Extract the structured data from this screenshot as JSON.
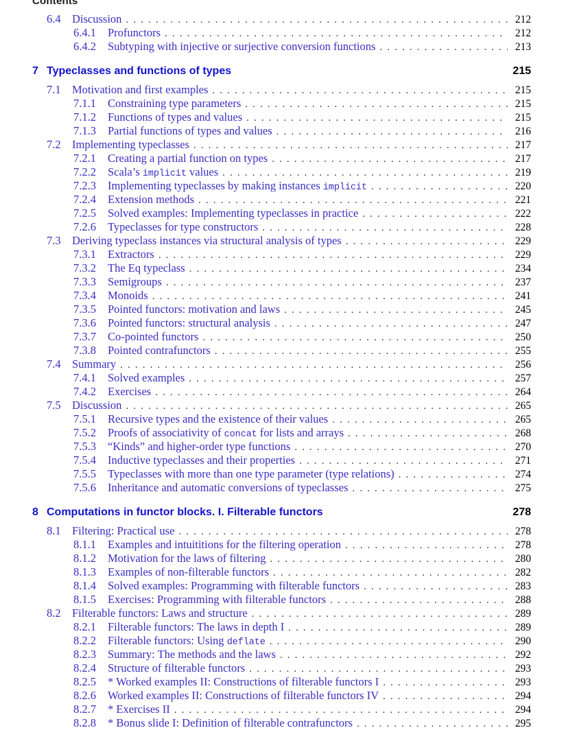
{
  "header": {
    "running_title": "Contents"
  },
  "toc": {
    "entries": [
      {
        "level": "section",
        "number": "6.4",
        "title": "Discussion",
        "page": "212"
      },
      {
        "level": "subsection",
        "number": "6.4.1",
        "title": "Profunctors",
        "page": "212"
      },
      {
        "level": "subsection",
        "number": "6.4.2",
        "title": "Subtyping with injective or surjective conversion functions",
        "page": "213"
      },
      {
        "level": "chapter",
        "number": "7",
        "title": "Typeclasses and functions of types",
        "page": "215"
      },
      {
        "level": "section",
        "number": "7.1",
        "title": "Motivation and first examples",
        "page": "215"
      },
      {
        "level": "subsection",
        "number": "7.1.1",
        "title": "Constraining type parameters",
        "page": "215"
      },
      {
        "level": "subsection",
        "number": "7.1.2",
        "title": "Functions of types and values",
        "page": "215"
      },
      {
        "level": "subsection",
        "number": "7.1.3",
        "title": "Partial functions of types and values",
        "page": "216"
      },
      {
        "level": "section",
        "number": "7.2",
        "title": "Implementing typeclasses",
        "page": "217"
      },
      {
        "level": "subsection",
        "number": "7.2.1",
        "title": "Creating a partial function on types",
        "page": "217"
      },
      {
        "level": "subsection",
        "number": "7.2.2",
        "title": "Scala’s implicit values",
        "title_parts": [
          {
            "t": "Scala’s ",
            "mono": false
          },
          {
            "t": "implicit",
            "mono": true
          },
          {
            "t": " values",
            "mono": false
          }
        ],
        "page": "219"
      },
      {
        "level": "subsection",
        "number": "7.2.3",
        "title": "Implementing typeclasses by making instances implicit",
        "title_parts": [
          {
            "t": "Implementing typeclasses by making instances ",
            "mono": false
          },
          {
            "t": "implicit",
            "mono": true
          }
        ],
        "page": "220"
      },
      {
        "level": "subsection",
        "number": "7.2.4",
        "title": "Extension methods",
        "page": "221"
      },
      {
        "level": "subsection",
        "number": "7.2.5",
        "title": "Solved examples: Implementing typeclasses in practice",
        "page": "222"
      },
      {
        "level": "subsection",
        "number": "7.2.6",
        "title": "Typeclasses for type constructors",
        "page": "228"
      },
      {
        "level": "section",
        "number": "7.3",
        "title": "Deriving typeclass instances via structural analysis of types",
        "page": "229"
      },
      {
        "level": "subsection",
        "number": "7.3.1",
        "title": "Extractors",
        "page": "229"
      },
      {
        "level": "subsection",
        "number": "7.3.2",
        "title": "The Eq typeclass",
        "page": "234"
      },
      {
        "level": "subsection",
        "number": "7.3.3",
        "title": "Semigroups",
        "page": "237"
      },
      {
        "level": "subsection",
        "number": "7.3.4",
        "title": "Monoids",
        "page": "241"
      },
      {
        "level": "subsection",
        "number": "7.3.5",
        "title": "Pointed functors: motivation and laws",
        "page": "245"
      },
      {
        "level": "subsection",
        "number": "7.3.6",
        "title": "Pointed functors: structural analysis",
        "page": "247"
      },
      {
        "level": "subsection",
        "number": "7.3.7",
        "title": "Co-pointed functors",
        "page": "250"
      },
      {
        "level": "subsection",
        "number": "7.3.8",
        "title": "Pointed contrafunctors",
        "page": "255"
      },
      {
        "level": "section",
        "number": "7.4",
        "title": "Summary",
        "page": "256"
      },
      {
        "level": "subsection",
        "number": "7.4.1",
        "title": "Solved examples",
        "page": "257"
      },
      {
        "level": "subsection",
        "number": "7.4.2",
        "title": "Exercises",
        "page": "264"
      },
      {
        "level": "section",
        "number": "7.5",
        "title": "Discussion",
        "page": "265"
      },
      {
        "level": "subsection",
        "number": "7.5.1",
        "title": "Recursive types and the existence of their values",
        "page": "265"
      },
      {
        "level": "subsection",
        "number": "7.5.2",
        "title": "Proofs of associativity of concat for lists and arrays",
        "title_parts": [
          {
            "t": "Proofs of associativity of ",
            "mono": false
          },
          {
            "t": "concat",
            "mono": true
          },
          {
            "t": " for lists and arrays",
            "mono": false
          }
        ],
        "page": "268"
      },
      {
        "level": "subsection",
        "number": "7.5.3",
        "title": "“Kinds” and higher-order type functions",
        "page": "270"
      },
      {
        "level": "subsection",
        "number": "7.5.4",
        "title": "Inductive typeclasses and their properties",
        "page": "271"
      },
      {
        "level": "subsection",
        "number": "7.5.5",
        "title": "Typeclasses with more than one type parameter (type relations)",
        "page": "274"
      },
      {
        "level": "subsection",
        "number": "7.5.6",
        "title": "Inheritance and automatic conversions of typeclasses",
        "page": "275"
      },
      {
        "level": "chapter",
        "number": "8",
        "title": "Computations in functor blocks. I. Filterable functors",
        "page": "278"
      },
      {
        "level": "section",
        "number": "8.1",
        "title": "Filtering: Practical use",
        "page": "278"
      },
      {
        "level": "subsection",
        "number": "8.1.1",
        "title": "Examples and intuititions for the filtering operation",
        "page": "278"
      },
      {
        "level": "subsection",
        "number": "8.1.2",
        "title": "Motivation for the laws of filtering",
        "page": "280"
      },
      {
        "level": "subsection",
        "number": "8.1.3",
        "title": "Examples of non-filterable functors",
        "page": "282"
      },
      {
        "level": "subsection",
        "number": "8.1.4",
        "title": "Solved examples: Programming with filterable functors",
        "page": "283"
      },
      {
        "level": "subsection",
        "number": "8.1.5",
        "title": "Exercises: Programming with filterable functors",
        "page": "288"
      },
      {
        "level": "section",
        "number": "8.2",
        "title": "Filterable functors: Laws and structure",
        "page": "289"
      },
      {
        "level": "subsection",
        "number": "8.2.1",
        "title": "Filterable functors: The laws in depth I",
        "page": "289"
      },
      {
        "level": "subsection",
        "number": "8.2.2",
        "title": "Filterable functors: Using deflate",
        "title_parts": [
          {
            "t": "Filterable functors: Using ",
            "mono": false
          },
          {
            "t": "deflate",
            "mono": true
          }
        ],
        "page": "290"
      },
      {
        "level": "subsection",
        "number": "8.2.3",
        "title": "Summary: The methods and the laws",
        "page": "292"
      },
      {
        "level": "subsection",
        "number": "8.2.4",
        "title": "Structure of filterable functors",
        "page": "293"
      },
      {
        "level": "subsection",
        "number": "8.2.5",
        "title": "* Worked examples II: Constructions of filterable functors I",
        "page": "293"
      },
      {
        "level": "subsection",
        "number": "8.2.6",
        "title": "Worked examples II: Constructions of filterable functors IV",
        "page": "294"
      },
      {
        "level": "subsection",
        "number": "8.2.7",
        "title": "* Exercises II",
        "page": "294"
      },
      {
        "level": "subsection",
        "number": "8.2.8",
        "title": "* Bonus slide I: Definition of filterable contrafunctors",
        "page": "295"
      }
    ]
  },
  "colors": {
    "chapter_blue": "#1414cc",
    "entry_blue": "#3a2fc0",
    "pageno_black": "#000000",
    "leader_gray": "#303030"
  }
}
